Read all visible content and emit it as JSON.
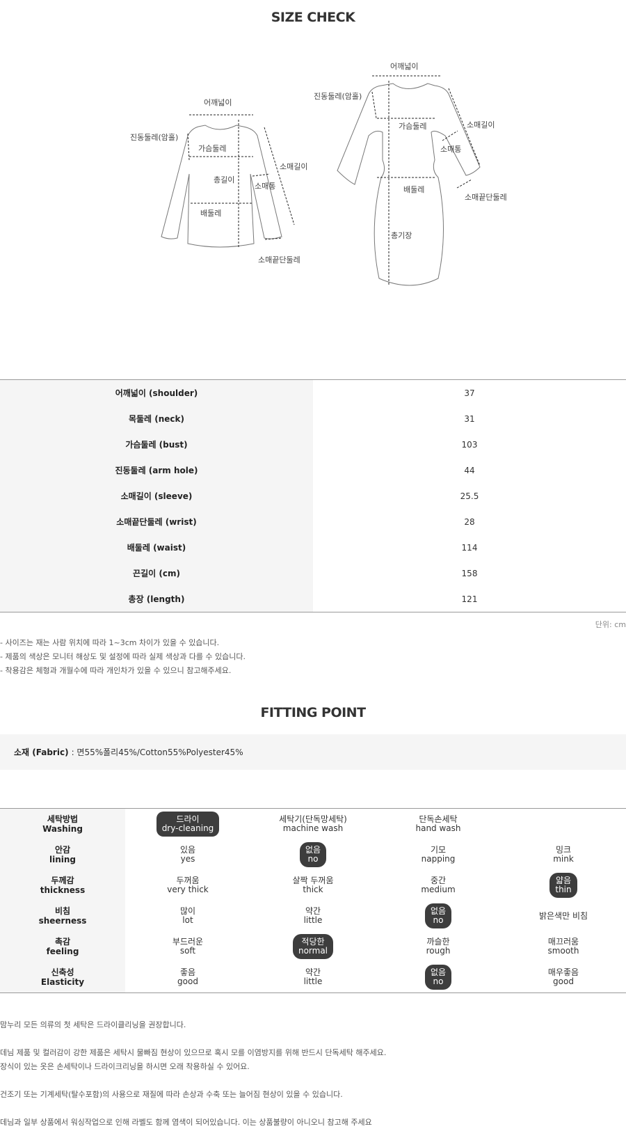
{
  "size_check_title": "SIZE CHECK",
  "diagram_labels": {
    "shirt": {
      "shoulder": "어깨넓이",
      "armhole": "진동둘레(암홀)",
      "bust": "가슴둘레",
      "length": "총길이",
      "sleeve_width": "소매통",
      "sleeve_length": "소매길이",
      "waist": "배둘레",
      "wrist": "소매끝단둘레"
    },
    "dress": {
      "shoulder": "어깨넓이",
      "armhole": "진동둘레(암홀)",
      "bust": "가슴둘레",
      "sleeve_length": "소매길이",
      "sleeve_width": "소매통",
      "waist": "배둘레",
      "wrist": "소매끝단둘레",
      "total_length": "총기장"
    }
  },
  "size_table": [
    {
      "label": "어깨넓이 (shoulder)",
      "value": "37"
    },
    {
      "label": "목둘레 (neck)",
      "value": "31"
    },
    {
      "label": "가슴둘레 (bust)",
      "value": "103"
    },
    {
      "label": "진동둘레 (arm hole)",
      "value": "44"
    },
    {
      "label": "소매길이 (sleeve)",
      "value": "25.5"
    },
    {
      "label": "소매끝단둘레 (wrist)",
      "value": "28"
    },
    {
      "label": "배둘레 (waist)",
      "value": "114"
    },
    {
      "label": "끈길이 (cm)",
      "value": "158"
    },
    {
      "label": "총장 (length)",
      "value": "121"
    }
  ],
  "unit": "단위: cm",
  "notes": [
    "- 사이즈는 재는 사람 위치에 따라 1~3cm 차이가 있을 수 있습니다.",
    "- 제품의 색상은 모니터 해상도 및 설정에 따라 실제 색상과 다를 수 있습니다.",
    "- 착용감은 체형과 개월수에 따라 개인차가 있을 수 있으니 참고해주세요."
  ],
  "fitting_title": "FITTING POINT",
  "fabric": {
    "label": "소재 (Fabric)",
    "value": ": 면55%폴리45%/Cotton55%Polyester45%"
  },
  "fitting_rows": [
    {
      "ko": "세탁방법",
      "en": "Washing",
      "options": [
        {
          "ko": "드라이",
          "en": "dry-cleaning",
          "selected": true
        },
        {
          "ko": "세탁기(단독망세탁)",
          "en": "machine wash",
          "selected": false
        },
        {
          "ko": "단독손세탁",
          "en": "hand wash",
          "selected": false
        },
        {
          "ko": "",
          "en": "",
          "selected": false
        }
      ]
    },
    {
      "ko": "안감",
      "en": "lining",
      "options": [
        {
          "ko": "있음",
          "en": "yes",
          "selected": false
        },
        {
          "ko": "없음",
          "en": "no",
          "selected": true
        },
        {
          "ko": "기모",
          "en": "napping",
          "selected": false
        },
        {
          "ko": "밍크",
          "en": "mink",
          "selected": false
        }
      ]
    },
    {
      "ko": "두께감",
      "en": "thickness",
      "options": [
        {
          "ko": "두꺼움",
          "en": "very thick",
          "selected": false
        },
        {
          "ko": "살짝 두꺼움",
          "en": "thick",
          "selected": false
        },
        {
          "ko": "중간",
          "en": "medium",
          "selected": false
        },
        {
          "ko": "얇음",
          "en": "thin",
          "selected": true
        }
      ]
    },
    {
      "ko": "비침",
      "en": "sheerness",
      "options": [
        {
          "ko": "많이",
          "en": "lot",
          "selected": false
        },
        {
          "ko": "약간",
          "en": "little",
          "selected": false
        },
        {
          "ko": "없음",
          "en": "no",
          "selected": true
        },
        {
          "ko": "밝은색만 비침",
          "en": "",
          "selected": false
        }
      ]
    },
    {
      "ko": "촉감",
      "en": "feeling",
      "options": [
        {
          "ko": "부드러운",
          "en": "soft",
          "selected": false
        },
        {
          "ko": "적당한",
          "en": "normal",
          "selected": true
        },
        {
          "ko": "까슬한",
          "en": "rough",
          "selected": false
        },
        {
          "ko": "매끄러움",
          "en": "smooth",
          "selected": false
        }
      ]
    },
    {
      "ko": "신축성",
      "en": "Elasticity",
      "options": [
        {
          "ko": "좋음",
          "en": "good",
          "selected": false
        },
        {
          "ko": "약간",
          "en": "little",
          "selected": false
        },
        {
          "ko": "없음",
          "en": "no",
          "selected": true
        },
        {
          "ko": "매우좋음",
          "en": "good",
          "selected": false
        }
      ]
    }
  ],
  "care_notes": [
    "맘누리 모든 의류의 첫 세탁은 드라이클리닝을 권장합니다.",
    "",
    "데님 제품 및 컬러감이 강한 제품은 세탁시 물빠짐 현상이 있으므로 혹시 모를 이염방지를 위해 반드시 단독세탁 해주세요.",
    "장식이 있는 옷은 손세탁이나 드라이크리닝을 하시면 오래 착용하실 수 있어요.",
    "",
    "건조기 또는 기계세탁(탈수포함)의 사용으로 재질에 따라 손상과 수축 또는 늘어짐 현상이 있을 수 있습니다.",
    "",
    "데님과 일부 상품에서 워싱작업으로 인해 라벨도 함께 염색이 되어있습니다. 이는 상품불량이 아니오니 참고해 주세요"
  ]
}
